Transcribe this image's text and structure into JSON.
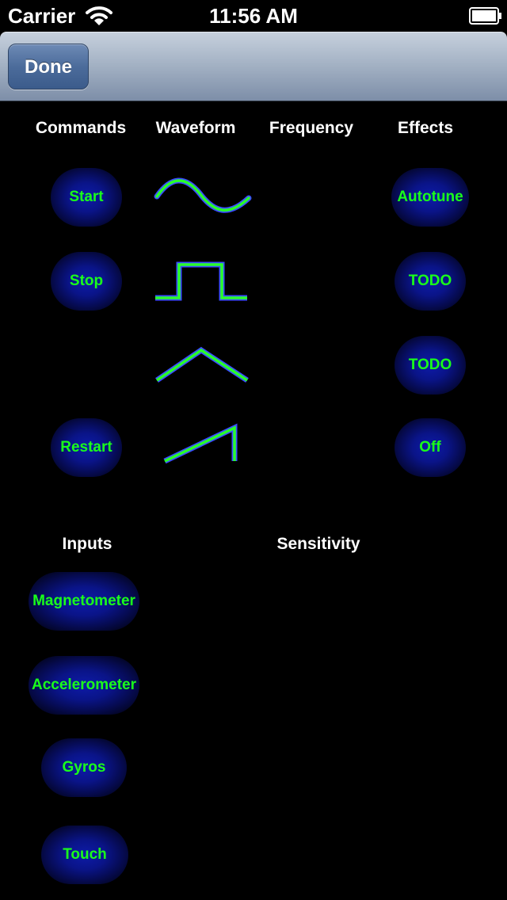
{
  "status_bar": {
    "carrier": "Carrier",
    "time": "11:56 AM"
  },
  "nav": {
    "done_label": "Done"
  },
  "columns": {
    "commands": "Commands",
    "waveform": "Waveform",
    "frequency": "Frequency",
    "effects": "Effects"
  },
  "commands": {
    "start": "Start",
    "stop": "Stop",
    "restart": "Restart"
  },
  "waveforms": [
    "sine-wave-icon",
    "square-wave-icon",
    "triangle-wave-icon",
    "sawtooth-wave-icon"
  ],
  "effects": {
    "autotune": "Autotune",
    "todo_1": "TODO",
    "todo_2": "TODO",
    "off": "Off"
  },
  "sections": {
    "inputs": "Inputs",
    "sensitivity": "Sensitivity"
  },
  "inputs": {
    "magnetometer": "Magnetometer",
    "accelerometer": "Accelerometer",
    "gyros": "Gyros",
    "touch": "Touch"
  },
  "colors": {
    "button_text": "#1aff1a",
    "button_glow": "#0a1488",
    "wave_fill": "#2aff2a",
    "wave_edge": "#3a4cff",
    "nav_bar": "#a5b3c5",
    "done_button": "#4c6c9b"
  }
}
